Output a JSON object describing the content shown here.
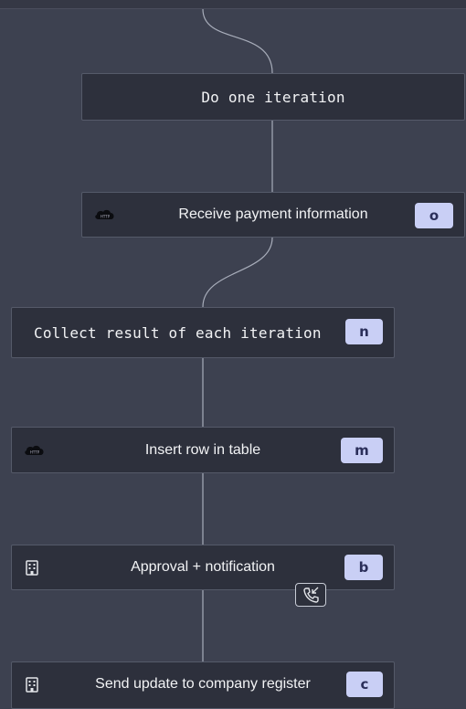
{
  "nodes": [
    {
      "label": "Do one iteration"
    },
    {
      "label": "Receive payment information",
      "badge": "o",
      "icon": "cloud-http-icon"
    },
    {
      "label": "Collect result of each iteration",
      "badge": "n"
    },
    {
      "label": "Insert row in table",
      "badge": "m",
      "icon": "cloud-http-icon"
    },
    {
      "label": "Approval + notification",
      "badge": "b",
      "icon": "building-icon",
      "extra_icon": "phone-incoming-icon"
    },
    {
      "label": "Send update to company register",
      "badge": "c",
      "icon": "building-icon"
    }
  ],
  "colors": {
    "canvas": "#3d4150",
    "node": "#2d303c",
    "connector": "#a8adba",
    "badge_bg": "#c9cff5",
    "badge_text": "#2b2f5a"
  }
}
